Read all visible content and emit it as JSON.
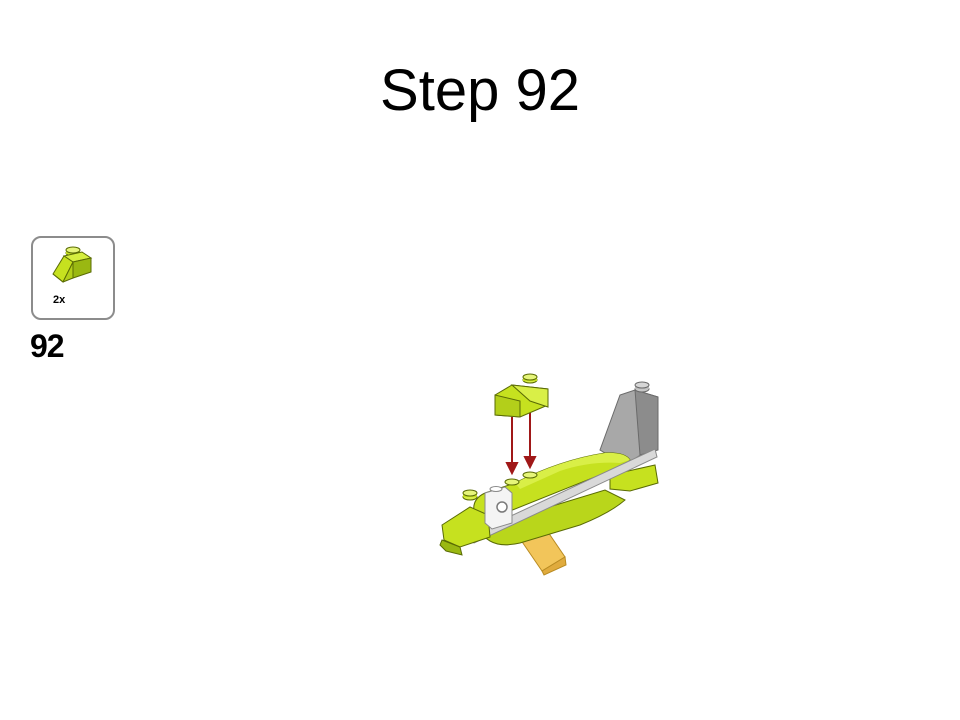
{
  "page": {
    "title": "Step 92"
  },
  "parts_list": {
    "items": [
      {
        "icon": "lime-slope-brick-icon",
        "quantity": "2x"
      }
    ],
    "step_number": "92"
  },
  "model": {
    "icon": "lime-fish-model-icon",
    "arrows": 2,
    "colors": {
      "lime": "#c6e11f",
      "lime_dark": "#9ab812",
      "gray": "#9a9a9a",
      "tan": "#f2c55a",
      "arrow": "#a01818"
    }
  }
}
